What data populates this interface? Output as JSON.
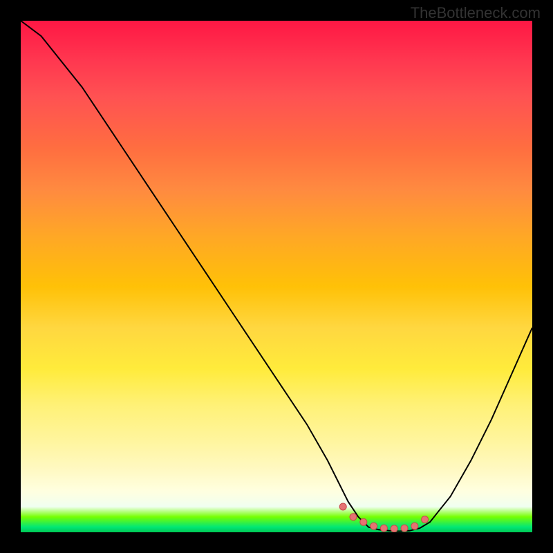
{
  "watermark": "TheBottleneck.com",
  "chart_data": {
    "type": "line",
    "title": "",
    "xlabel": "",
    "ylabel": "",
    "xlim": [
      0,
      100
    ],
    "ylim": [
      0,
      100
    ],
    "grid": false,
    "series": [
      {
        "name": "curve",
        "x": [
          0,
          4,
          8,
          12,
          16,
          20,
          24,
          28,
          32,
          36,
          40,
          44,
          48,
          52,
          56,
          60,
          62,
          64,
          66,
          68,
          70,
          72,
          74,
          76,
          78,
          80,
          84,
          88,
          92,
          96,
          100
        ],
        "values": [
          100,
          97,
          92,
          87,
          81,
          75,
          69,
          63,
          57,
          51,
          45,
          39,
          33,
          27,
          21,
          14,
          10,
          6,
          3,
          1,
          0.5,
          0.3,
          0.2,
          0.3,
          0.8,
          2,
          7,
          14,
          22,
          31,
          40
        ]
      }
    ],
    "markers": {
      "name": "bottom-markers",
      "x": [
        63,
        65,
        67,
        69,
        71,
        73,
        75,
        77,
        79
      ],
      "values": [
        5,
        3,
        2,
        1.2,
        0.8,
        0.7,
        0.8,
        1.2,
        2.5
      ]
    }
  }
}
